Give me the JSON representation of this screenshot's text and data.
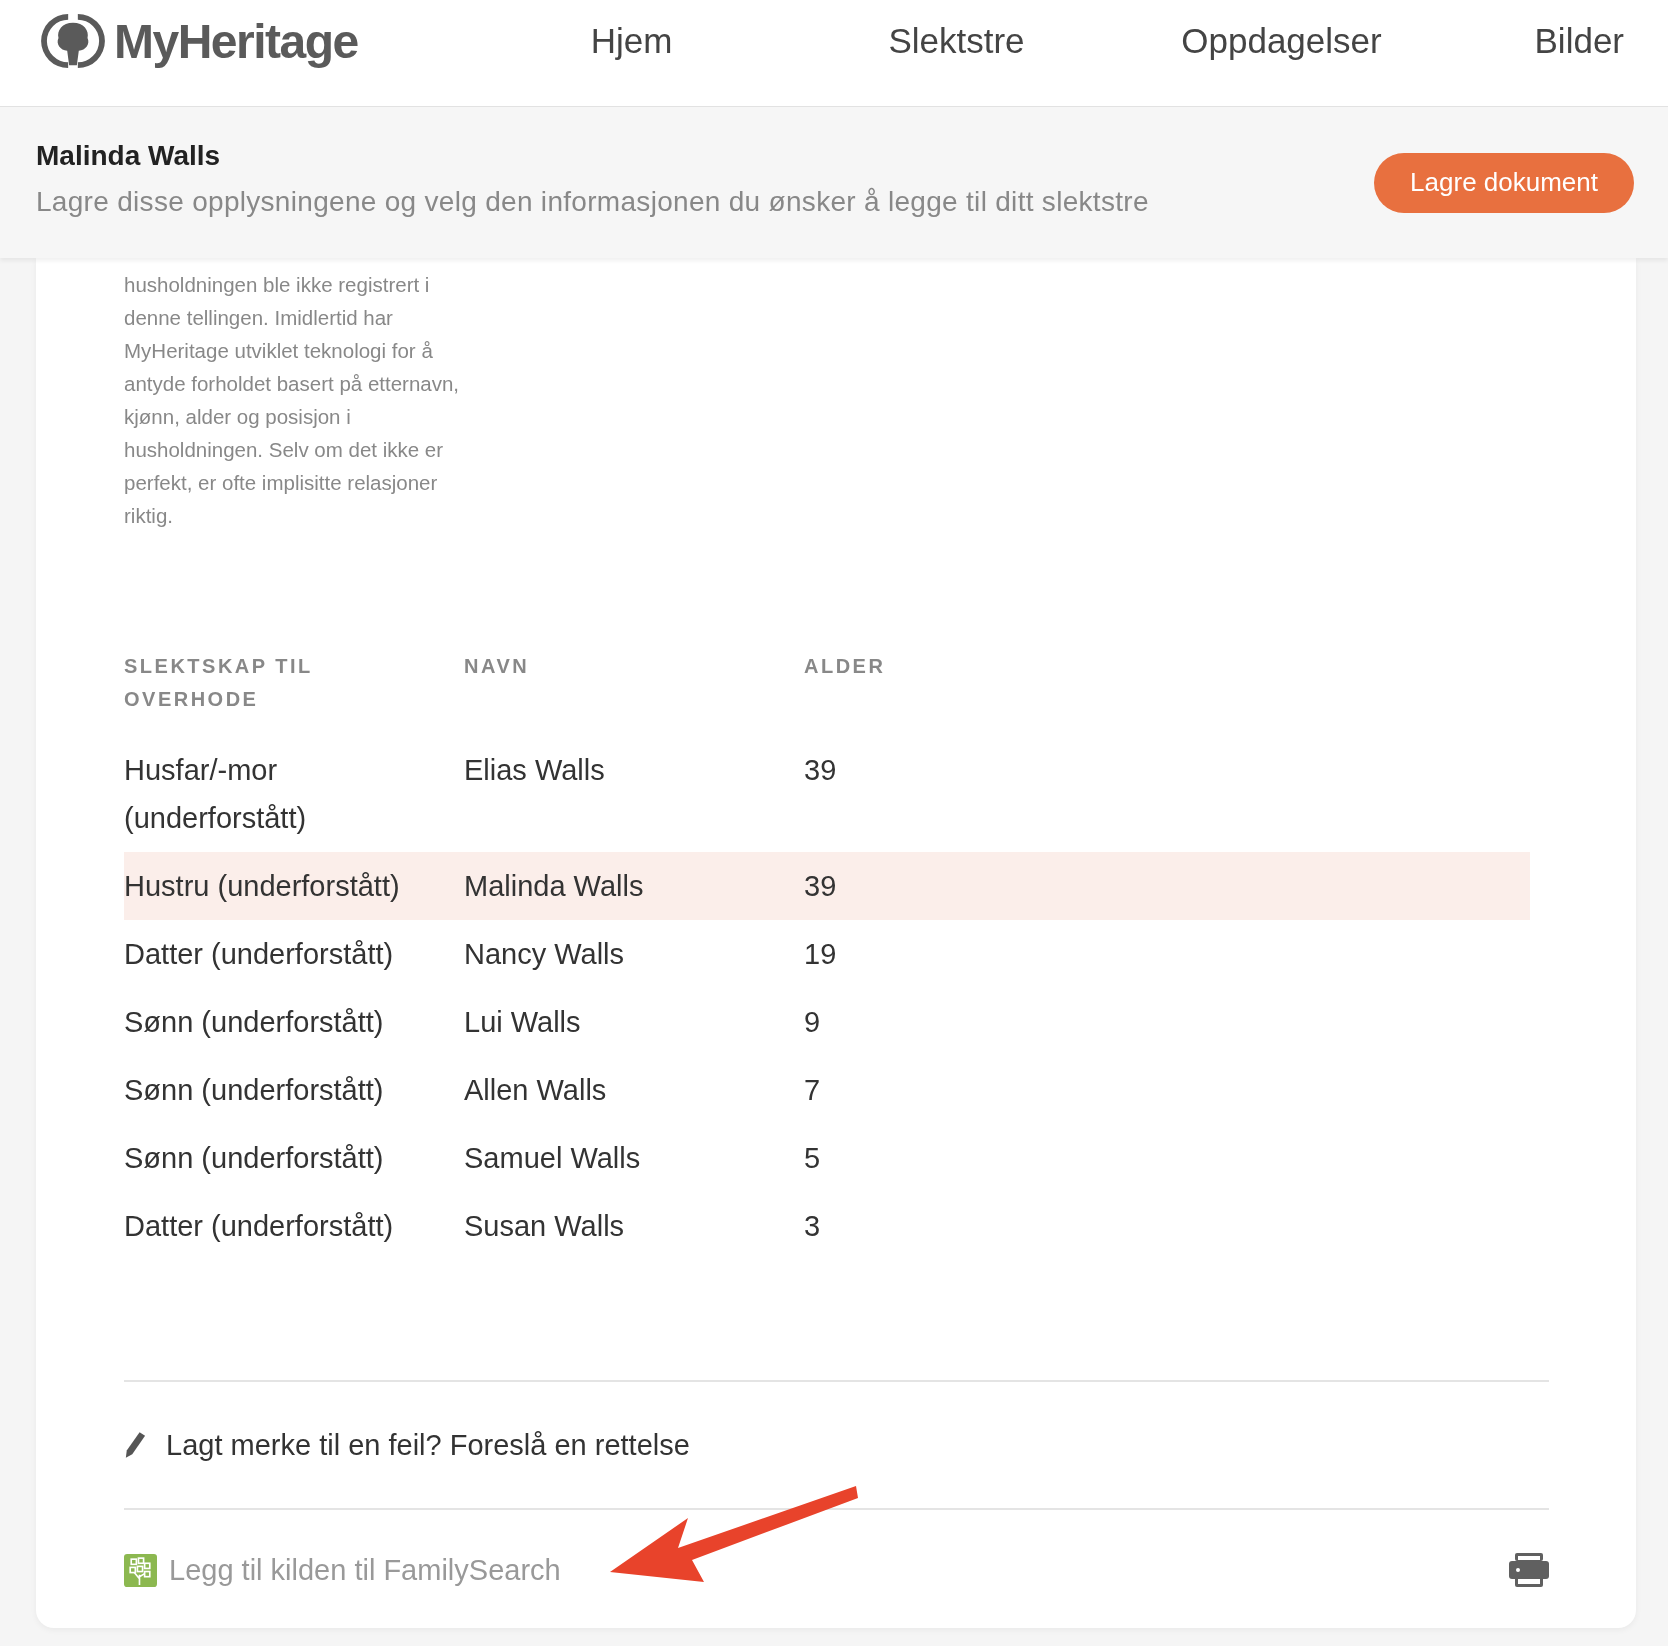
{
  "header": {
    "logo": "MyHeritage",
    "nav": [
      {
        "label": "Hjem"
      },
      {
        "label": "Slektstre"
      },
      {
        "label": "Oppdagelser"
      },
      {
        "label": "Bilder"
      }
    ]
  },
  "record_bar": {
    "name": "Malinda Walls",
    "subtitle": "Lagre disse opplysningene og velg den informasjonen du ønsker å legge til ditt slektstre",
    "button": "Lagre dokument"
  },
  "note": "husholdningen ble ikke registrert i denne tellingen. Imidlertid har MyHeritage utviklet teknologi for å antyde forholdet basert på etternavn, kjønn, alder og posisjon i husholdningen. Selv om det ikke er perfekt, er ofte implisitte relasjoner riktig.",
  "table": {
    "columns": [
      "SLEKTSKAP TIL OVERHODE",
      "NAVN",
      "ALDER"
    ],
    "rows": [
      {
        "relation": "Husfar/-mor (underforstått)",
        "name": "Elias Walls",
        "age": "39",
        "selected": false
      },
      {
        "relation": "Hustru (underforstått)",
        "name": "Malinda Walls",
        "age": "39",
        "selected": true
      },
      {
        "relation": "Datter (underforstått)",
        "name": "Nancy Walls",
        "age": "19",
        "selected": false
      },
      {
        "relation": "Sønn (underforstått)",
        "name": "Lui Walls",
        "age": "9",
        "selected": false
      },
      {
        "relation": "Sønn (underforstått)",
        "name": "Allen Walls",
        "age": "7",
        "selected": false
      },
      {
        "relation": "Sønn (underforstått)",
        "name": "Samuel Walls",
        "age": "5",
        "selected": false
      },
      {
        "relation": "Datter (underforstått)",
        "name": "Susan Walls",
        "age": "3",
        "selected": false
      }
    ]
  },
  "correction_link": "Lagt merke til en feil? Foreslå en rettelse",
  "familysearch_link": "Legg til kilden til FamilySearch"
}
